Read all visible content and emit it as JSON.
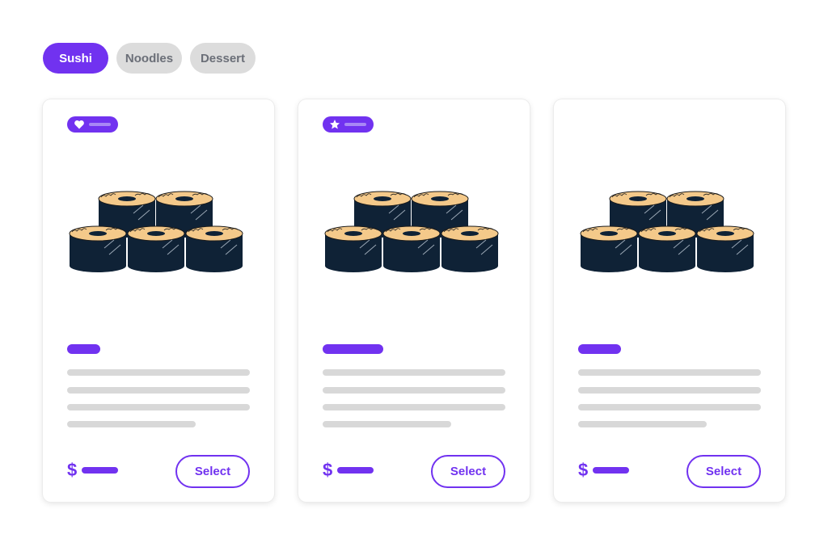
{
  "filter_tabs": [
    {
      "label": "Sushi",
      "active": true
    },
    {
      "label": "Noodles",
      "active": false
    },
    {
      "label": "Dessert",
      "active": false
    }
  ],
  "cards": [
    {
      "badge_icon": "heart-icon",
      "image": "sushi-rolls-illustration",
      "price_symbol": "$",
      "action_label": "Select"
    },
    {
      "badge_icon": "star-icon",
      "image": "sushi-rolls-illustration",
      "price_symbol": "$",
      "action_label": "Select"
    },
    {
      "badge_icon": "",
      "image": "sushi-rolls-illustration",
      "price_symbol": "$",
      "action_label": "Select"
    }
  ],
  "colors": {
    "accent": "#7132f0",
    "accent_light": "#a887f5",
    "tab_inactive_bg": "#dcdcdc",
    "tab_inactive_text": "#6b6f78",
    "placeholder": "#d8d8d8",
    "roll_wrap": "#0f2236",
    "roll_rice": "#f4c98a"
  }
}
